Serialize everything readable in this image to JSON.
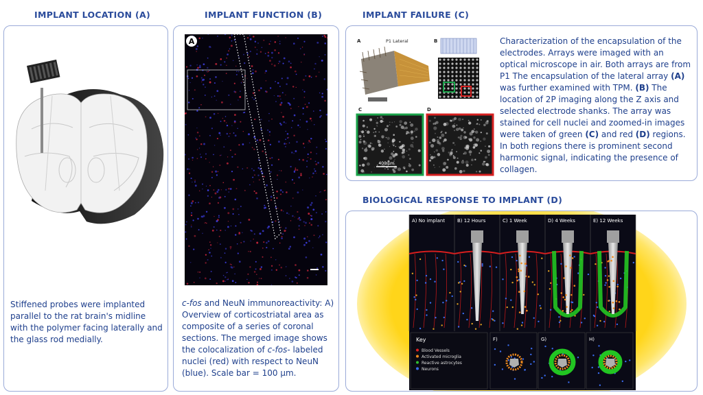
{
  "headings": {
    "location": {
      "text": "IMPLANT LOCATION ",
      "tag": "(A)"
    },
    "function": {
      "text": "IMPLANT FUNCTION ",
      "tag": "(B)"
    },
    "failure": {
      "text": "IMPLANT FAILURE ",
      "tag": "(C)"
    },
    "response": {
      "text": "BIOLOGICAL RESPONSE TO IMPLANT ",
      "tag": "(D)"
    }
  },
  "location": {
    "caption": "Stiffened probes were implanted parallel to the rat brain's midline with the polymer facing laterally and the glass rod medially."
  },
  "function": {
    "image_label": "A",
    "caption_cfos": "c-fos",
    "caption_part1": " and NeuN immunoreactivity: A) Overview of corticostriatal area as composite of a series of coronal sections. The merged image shows the colocalization of ",
    "caption_cfos2": "c-fos-",
    "caption_part2": " labeled nuclei (red) with respect to NeuN (blue). Scale bar = 100 µm."
  },
  "failure": {
    "t1": "Characterization of the encapsulation of the electrodes. Arrays were imaged with an optical microscope in air. Both arrays are from P1 The encapsulation of the lateral array ",
    "tA": "(A)",
    "t2": " was further examined with TPM. ",
    "tB": "(B)",
    "t3": " The location of 2P imaging along the Z axis and selected electrode shanks. The array was stained for cell nuclei and zoomed-in images were taken of green ",
    "tC": "(C)",
    "t4": " and red ",
    "tD": "(D)",
    "t5": " regions. In both regions there is prominent second harmonic signal, indicating the presence of collagen.",
    "fig": {
      "label_a": "A",
      "label_a_title": "P1 Lateral",
      "label_b": "B",
      "label_c": "C",
      "label_d": "D",
      "scale": "400 µm"
    }
  },
  "response": {
    "stages": [
      "A) No implant",
      "B) 12 Hours",
      "C) 1 Week",
      "D) 4 Weeks",
      "E) 12 Weeks"
    ],
    "sub_labels": [
      "F)",
      "G)",
      "H)"
    ],
    "key_title": "Key",
    "key_items": [
      {
        "label": "Blood Vessels",
        "color": "#e02020"
      },
      {
        "label": "Activated microglia",
        "color": "#f08a1c"
      },
      {
        "label": "Reactive astrocytes",
        "color": "#2fc02f"
      },
      {
        "label": "Neurons",
        "color": "#3a6cf0"
      }
    ]
  }
}
